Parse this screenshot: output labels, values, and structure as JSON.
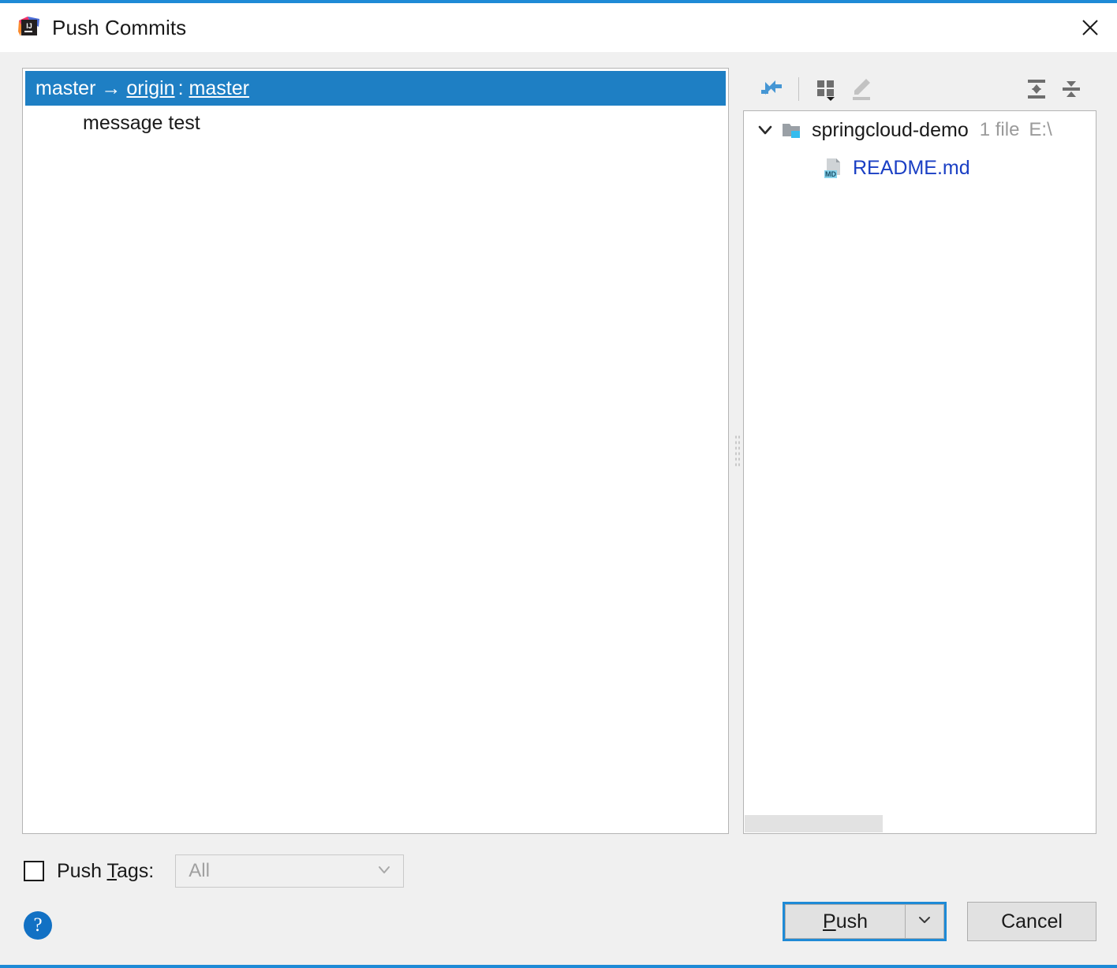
{
  "window": {
    "title": "Push Commits",
    "app_icon": "intellij-idea-icon",
    "close_icon": "close-icon",
    "accent_color": "#1e8ad6"
  },
  "commits": {
    "branch_row": {
      "local_branch": "master",
      "arrow": "→",
      "remote": "origin",
      "separator": ":",
      "remote_branch": "master",
      "selected_color": "#1e7fc4"
    },
    "entries": [
      {
        "message": "message test"
      }
    ]
  },
  "files_toolbar": {
    "buttons": [
      {
        "name": "show-diff-icon",
        "tooltip": "Show Diff"
      },
      {
        "name": "group-by-icon",
        "tooltip": "Group By"
      },
      {
        "name": "edit-source-icon",
        "tooltip": "Edit Source"
      },
      {
        "name": "expand-all-icon",
        "tooltip": "Expand All"
      },
      {
        "name": "collapse-all-icon",
        "tooltip": "Collapse All"
      }
    ]
  },
  "files_tree": {
    "root": {
      "label": "springcloud-demo",
      "file_count": "1 file",
      "path": "E:\\",
      "expanded": true,
      "chevron": "chevron-down-icon",
      "icon": "module-folder-icon"
    },
    "children": [
      {
        "label": "README.md",
        "icon": "markdown-file-icon",
        "badge": "MD",
        "color": "#1a3fc4"
      }
    ]
  },
  "push_tags": {
    "label_before": "Push ",
    "label_mnemonic": "T",
    "label_after": "ags:",
    "checked": false,
    "select_value": "All",
    "select_enabled": false
  },
  "footer": {
    "help_label": "?",
    "push_label_before": "",
    "push_mnemonic": "P",
    "push_label_after": "ush",
    "push_dropdown_icon": "chevron-down-icon",
    "cancel_label": "Cancel"
  }
}
